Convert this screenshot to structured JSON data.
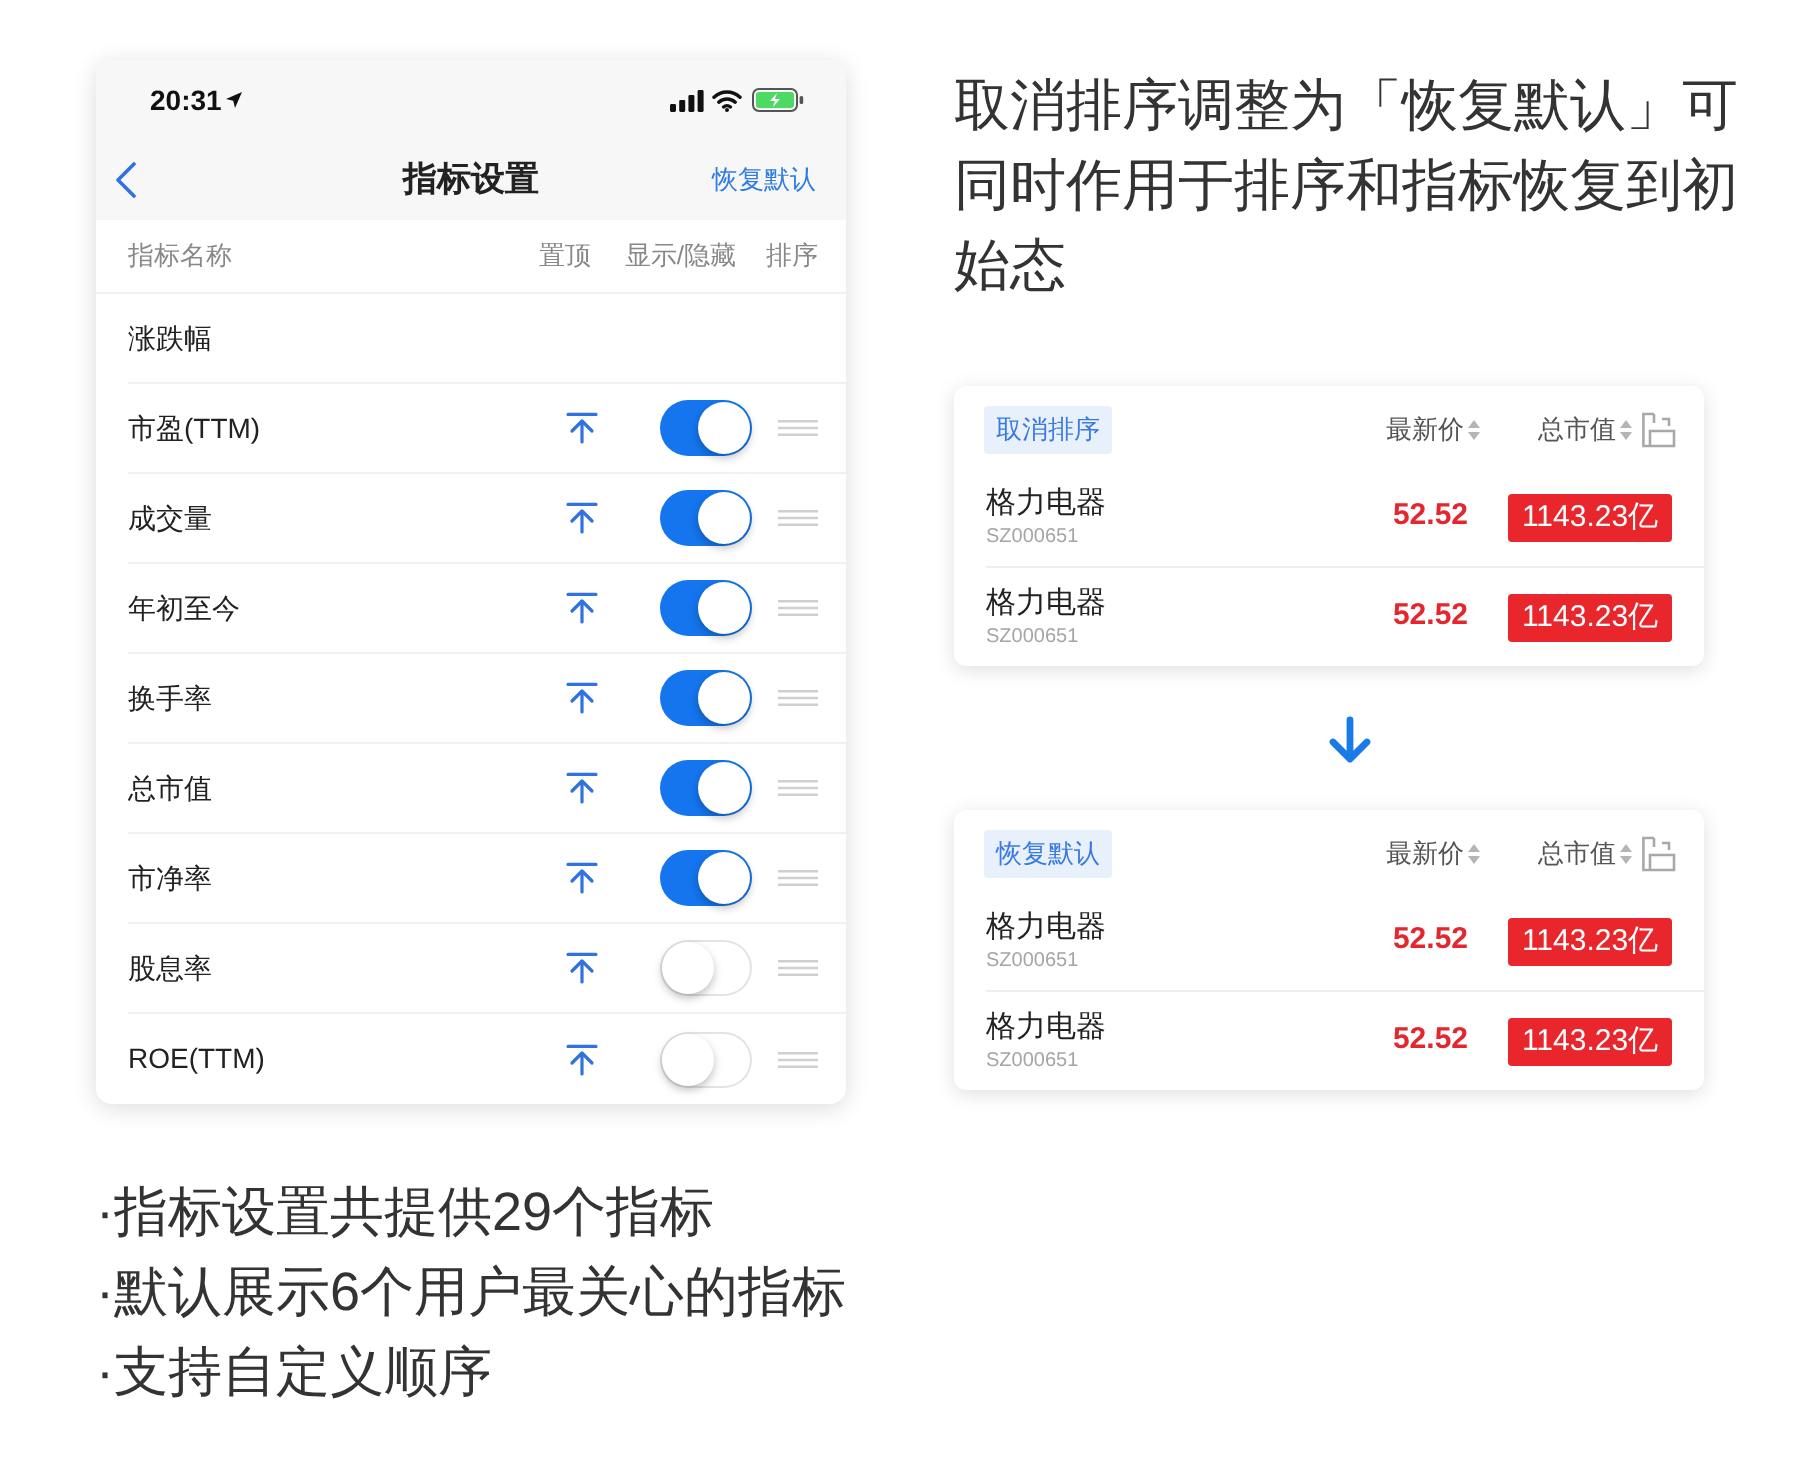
{
  "phone": {
    "status_bar": {
      "time": "20:31"
    },
    "nav_bar": {
      "title": "指标设置",
      "action": "恢复默认"
    },
    "columns": [
      "指标名称",
      "置顶",
      "显示/隐藏",
      "排序"
    ],
    "rows": [
      {
        "kind": "fixed",
        "name": "涨跌幅"
      },
      {
        "kind": "toggle",
        "name": "市盈(TTM)",
        "on": true
      },
      {
        "kind": "toggle",
        "name": "成交量",
        "on": true
      },
      {
        "kind": "toggle",
        "name": "年初至今",
        "on": true
      },
      {
        "kind": "toggle",
        "name": "换手率",
        "on": true
      },
      {
        "kind": "toggle",
        "name": "总市值",
        "on": true
      },
      {
        "kind": "toggle",
        "name": "市净率",
        "on": true
      },
      {
        "kind": "toggle",
        "name": "股息率",
        "on": false
      },
      {
        "kind": "toggle",
        "name": "ROE(TTM)",
        "on": false
      }
    ]
  },
  "heading": "取消排序调整为「恢复默认」可同时作用于排序和指标恢复到初始态",
  "cards": [
    {
      "button": "取消排序",
      "columns": [
        "最新价",
        "总市值"
      ],
      "rows": [
        {
          "name": "格力电器",
          "code": "SZ000651",
          "price": "52.52",
          "market_cap": "1143.23亿"
        },
        {
          "name": "格力电器",
          "code": "SZ000651",
          "price": "52.52",
          "market_cap": "1143.23亿"
        }
      ]
    },
    {
      "button": "恢复默认",
      "columns": [
        "最新价",
        "总市值"
      ],
      "rows": [
        {
          "name": "格力电器",
          "code": "SZ000651",
          "price": "52.52",
          "market_cap": "1143.23亿"
        },
        {
          "name": "格力电器",
          "code": "SZ000651",
          "price": "52.52",
          "market_cap": "1143.23亿"
        }
      ]
    }
  ],
  "notes": [
    "·指标设置共提供29个指标",
    "·默认展示6个用户最关心的指标",
    "·支持自定义顺序"
  ]
}
